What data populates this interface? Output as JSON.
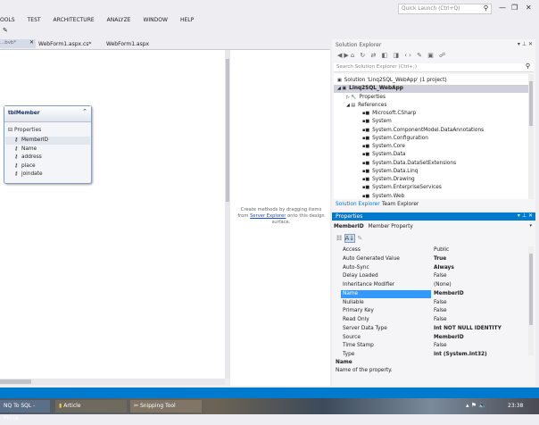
{
  "titlebar": {
    "quick_launch_placeholder": "Quick Launch (Ctrl+Q)",
    "search_icon": "search-icon"
  },
  "menu": [
    "OOLS",
    "TEST",
    "ARCHITECTURE",
    "ANALYZE",
    "WINDOW",
    "HELP"
  ],
  "tabs": [
    {
      "label": "...bvb*",
      "active": true
    },
    {
      "label": "WebForm1.aspx.cs*"
    },
    {
      "label": "WebForm1.aspx"
    }
  ],
  "entity": {
    "title": "tblMember",
    "section": "Properties",
    "properties": [
      "MemberID",
      "Name",
      "address",
      "place",
      "joindate"
    ]
  },
  "methods_pane": {
    "text_before": "Create methods by dragging items from",
    "link": "Server Explorer",
    "text_after": "onto this design surface."
  },
  "solution_explorer": {
    "title": "Solution Explorer",
    "search_placeholder": "Search Solution Explorer (Ctrl+;)",
    "solution": "Solution 'Linq2SQL_WebApp' (1 project)",
    "project": "Linq2SQL_WebApp",
    "properties": "Properties",
    "references": "References",
    "reference_items": [
      "Microsoft.CSharp",
      "System",
      "System.ComponentModel.DataAnnotations",
      "System.Configuration",
      "System.Core",
      "System.Data",
      "System.Data.DataSetExtensions",
      "System.Data.Linq",
      "System.Drawing",
      "System.EnterpriseServices",
      "System.Web"
    ],
    "bottom_tabs": [
      "Solution Explorer",
      "Team Explorer"
    ]
  },
  "properties_panel": {
    "title": "Properties",
    "object_name": "MemberID",
    "object_type": "Member Property",
    "rows": [
      {
        "key": "Access",
        "value": "Public",
        "bold": false
      },
      {
        "key": "Auto Generated Value",
        "value": "True",
        "bold": true
      },
      {
        "key": "Auto-Sync",
        "value": "Always",
        "bold": true
      },
      {
        "key": "Delay Loaded",
        "value": "False",
        "bold": false
      },
      {
        "key": "Inheritance Modifier",
        "value": "(None)",
        "bold": false
      },
      {
        "key": "Name",
        "value": "MemberID",
        "bold": true,
        "selected": true
      },
      {
        "key": "Nullable",
        "value": "False",
        "bold": false
      },
      {
        "key": "Primary Key",
        "value": "False",
        "bold": false
      },
      {
        "key": "Read Only",
        "value": "False",
        "bold": false
      },
      {
        "key": "Server Data Type",
        "value": "Int NOT NULL IDENTITY",
        "bold": true
      },
      {
        "key": "Source",
        "value": "MemberID",
        "bold": true
      },
      {
        "key": "Time Stamp",
        "value": "False",
        "bold": false
      },
      {
        "key": "Type",
        "value": "int (System.Int32)",
        "bold": true
      }
    ],
    "desc_title": "Name",
    "desc_text": "Name of the property."
  },
  "taskbar": {
    "items": [
      "NQ To SQL - Micro...",
      "Article",
      "Snipping Tool"
    ],
    "clock": "23:38"
  },
  "colors": {
    "accent": "#007acc",
    "selection": "#3399ff",
    "statusbar": "#007acc"
  }
}
